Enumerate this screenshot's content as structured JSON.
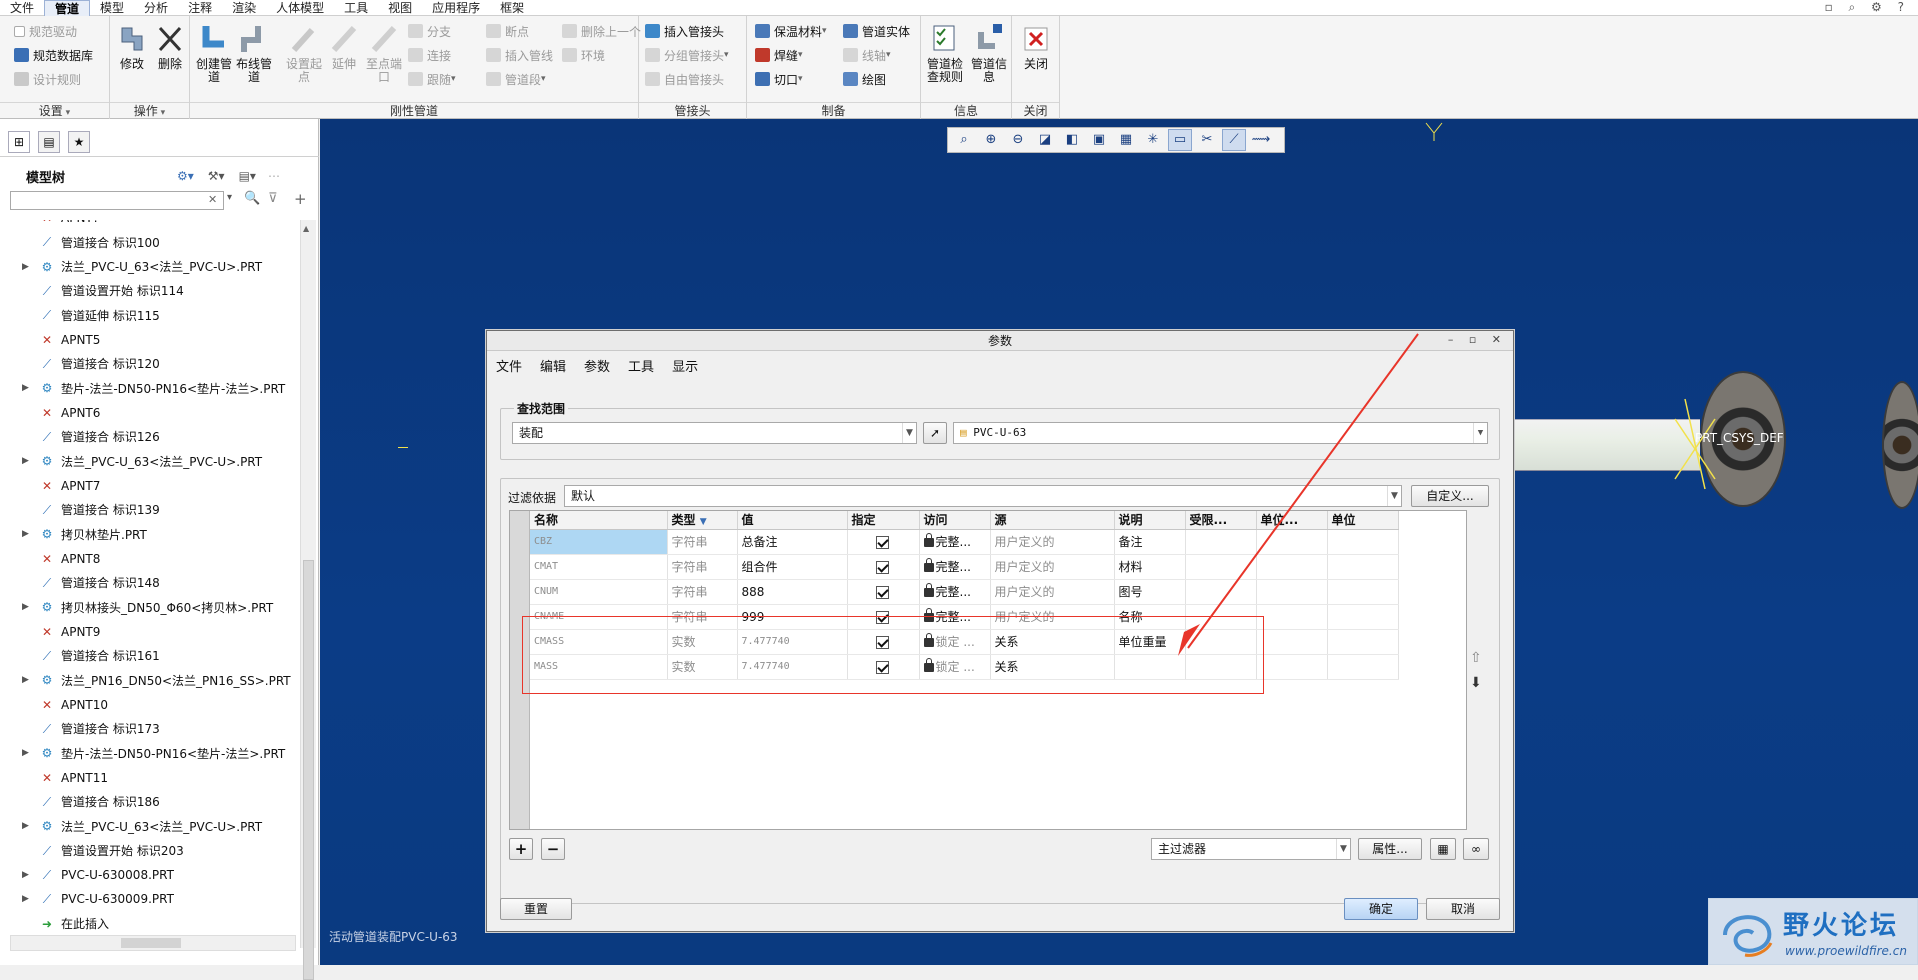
{
  "menubar": {
    "items": [
      "文件",
      "管道",
      "模型",
      "分析",
      "注释",
      "渲染",
      "人体模型",
      "工具",
      "视图",
      "应用程序",
      "框架"
    ],
    "active": "管道"
  },
  "ribbon": {
    "groups": {
      "settings": {
        "title": "设置",
        "items": [
          "规范驱动",
          "规范数据库",
          "设计规则"
        ]
      },
      "operations": {
        "title": "操作",
        "items": [
          "修改",
          "删除"
        ]
      },
      "rigid": {
        "title": "刚性管道",
        "big": [
          "创建管道",
          "布线管道",
          "设置起点",
          "延伸",
          "至点端口"
        ],
        "small": [
          "分支",
          "连接",
          "跟随",
          "断点",
          "插入管线",
          "管道段",
          "删除上一个",
          "环境"
        ]
      },
      "fittings": {
        "title": "管接头",
        "items": [
          "插入管接头",
          "分组管接头",
          "自由管接头"
        ]
      },
      "fab": {
        "title": "制备",
        "items": [
          "保温材料",
          "焊缝",
          "切口",
          "管道实体",
          "线轴",
          "绘图"
        ]
      },
      "info": {
        "title": "信息",
        "items": [
          "管道检查规则",
          "管道信息"
        ]
      },
      "close": {
        "title": "关闭",
        "items": [
          "关闭"
        ]
      }
    }
  },
  "model_tree": {
    "title": "模型树",
    "search_placeholder": "",
    "items": [
      {
        "label": "APNT?",
        "icon": "datum-point-icon",
        "expandable": false
      },
      {
        "label": "管道接合 标识100",
        "icon": "pipe-joint-icon",
        "expandable": false
      },
      {
        "label": "法兰_PVC-U_63<法兰_PVC-U>.PRT",
        "icon": "part-icon",
        "expandable": true
      },
      {
        "label": "管道设置开始 标识114",
        "icon": "pipe-start-icon",
        "expandable": false
      },
      {
        "label": "管道延伸 标识115",
        "icon": "pipe-extend-icon",
        "expandable": false
      },
      {
        "label": "APNT5",
        "icon": "datum-point-icon",
        "expandable": false
      },
      {
        "label": "管道接合 标识120",
        "icon": "pipe-joint-icon",
        "expandable": false
      },
      {
        "label": "垫片-法兰-DN50-PN16<垫片-法兰>.PRT",
        "icon": "part-icon",
        "expandable": true
      },
      {
        "label": "APNT6",
        "icon": "datum-point-icon",
        "expandable": false
      },
      {
        "label": "管道接合 标识126",
        "icon": "pipe-joint-icon",
        "expandable": false
      },
      {
        "label": "法兰_PVC-U_63<法兰_PVC-U>.PRT",
        "icon": "part-icon",
        "expandable": true
      },
      {
        "label": "APNT7",
        "icon": "datum-point-icon",
        "expandable": false
      },
      {
        "label": "管道接合 标识139",
        "icon": "pipe-joint-icon",
        "expandable": false
      },
      {
        "label": "拷贝林垫片.PRT",
        "icon": "part-icon",
        "expandable": true
      },
      {
        "label": "APNT8",
        "icon": "datum-point-icon",
        "expandable": false
      },
      {
        "label": "管道接合 标识148",
        "icon": "pipe-joint-icon",
        "expandable": false
      },
      {
        "label": "拷贝林接头_DN50_Φ60<拷贝林>.PRT",
        "icon": "part-icon",
        "expandable": true
      },
      {
        "label": "APNT9",
        "icon": "datum-point-icon",
        "expandable": false
      },
      {
        "label": "管道接合 标识161",
        "icon": "pipe-joint-icon",
        "expandable": false
      },
      {
        "label": "法兰_PN16_DN50<法兰_PN16_SS>.PRT",
        "icon": "part-icon",
        "expandable": true
      },
      {
        "label": "APNT10",
        "icon": "datum-point-icon",
        "expandable": false
      },
      {
        "label": "管道接合 标识173",
        "icon": "pipe-joint-icon",
        "expandable": false
      },
      {
        "label": "垫片-法兰-DN50-PN16<垫片-法兰>.PRT",
        "icon": "part-icon",
        "expandable": true
      },
      {
        "label": "APNT11",
        "icon": "datum-point-icon",
        "expandable": false
      },
      {
        "label": "管道接合 标识186",
        "icon": "pipe-joint-icon",
        "expandable": false
      },
      {
        "label": "法兰_PVC-U_63<法兰_PVC-U>.PRT",
        "icon": "part-icon",
        "expandable": true
      },
      {
        "label": "管道设置开始 标识203",
        "icon": "pipe-start-icon",
        "expandable": false
      },
      {
        "label": "PVC-U-630008.PRT",
        "icon": "pipe-part-icon",
        "expandable": true
      },
      {
        "label": "PVC-U-630009.PRT",
        "icon": "pipe-part-icon",
        "expandable": true
      },
      {
        "label": "在此插入",
        "icon": "insert-arrow-icon",
        "expandable": false
      }
    ]
  },
  "viewport": {
    "status": "活动管道装配PVC-U-63",
    "csys_label": "PRT_CSYS_DEF"
  },
  "dialog": {
    "title": "参数",
    "menu": [
      "文件",
      "编辑",
      "参数",
      "工具",
      "显示"
    ],
    "lookin_legend": "查找范围",
    "lookin_type": "装配",
    "lookin_object": "PVC-U-63",
    "filter_label": "过滤依据",
    "filter_value": "默认",
    "customize_label": "自定义...",
    "columns": [
      "名称",
      "类型",
      "值",
      "指定",
      "访问",
      "源",
      "说明",
      "受限...",
      "单位...",
      "单位"
    ],
    "rows": [
      {
        "name": "CBZ",
        "type": "字符串",
        "value": "总备注",
        "designated": true,
        "access": "完整...",
        "source": "用户定义的",
        "desc": "备注"
      },
      {
        "name": "CMAT",
        "type": "字符串",
        "value": "组合件",
        "designated": true,
        "access": "完整...",
        "source": "用户定义的",
        "desc": "材料"
      },
      {
        "name": "CNUM",
        "type": "字符串",
        "value": "888",
        "designated": true,
        "access": "完整...",
        "source": "用户定义的",
        "desc": "图号"
      },
      {
        "name": "CNAME",
        "type": "字符串",
        "value": "999",
        "designated": true,
        "access": "完整...",
        "source": "用户定义的",
        "desc": "名称"
      },
      {
        "name": "CMASS",
        "type": "实数",
        "value": "7.477740",
        "designated": true,
        "access": "锁定 ...",
        "source": "关系",
        "desc": "单位重量"
      },
      {
        "name": "MASS",
        "type": "实数",
        "value": "7.477740",
        "designated": true,
        "access": "锁定 ...",
        "source": "关系",
        "desc": ""
      }
    ],
    "main_filter": "主过滤器",
    "properties_label": "属性...",
    "reset_label": "重置",
    "ok_label": "确定",
    "cancel_label": "取消"
  },
  "watermark": {
    "title": "野火论坛",
    "url": "www.proewildfire.cn"
  },
  "colors": {
    "viewport_bg": "#0b3c86",
    "annotation_red": "#e8352a",
    "selected_cell": "#aed7f3"
  }
}
